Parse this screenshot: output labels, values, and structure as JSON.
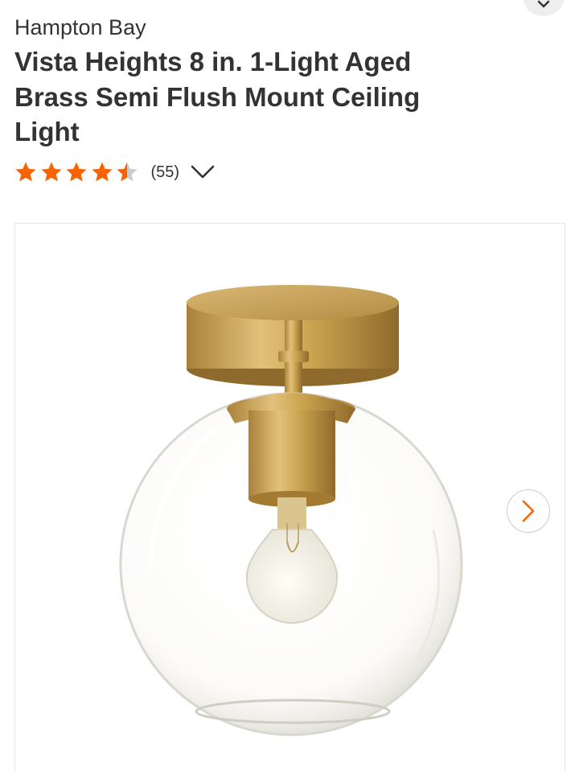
{
  "header": {
    "top_button_icon": "chevron-down-icon"
  },
  "product": {
    "brand": "Hampton Bay",
    "title": "Vista Heights 8 in. 1-Light Aged Brass Semi Flush Mount Ceiling Light",
    "rating": {
      "value": 4.5,
      "max": 5,
      "review_count": "(55)",
      "expand_icon": "chevron-down-icon"
    }
  },
  "gallery": {
    "image_icon": "ceiling-light-product-image",
    "next_icon": "chevron-right-icon"
  },
  "colors": {
    "accent": "#f96302",
    "text": "#333333",
    "star_empty": "#cccccc",
    "brass": "#c9a24e"
  }
}
